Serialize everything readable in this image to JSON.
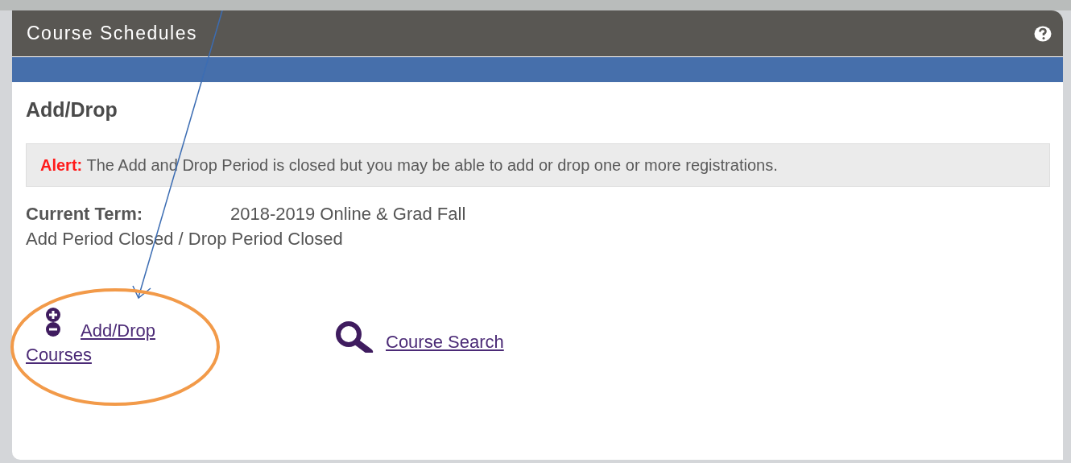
{
  "panel": {
    "title": "Course Schedules"
  },
  "heading": "Add/Drop",
  "alert": {
    "label": "Alert:",
    "message": "The Add and Drop Period is closed but you may be able to add or drop one or more registrations."
  },
  "current_term": {
    "label": "Current Term:",
    "value": "2018-2019 Online & Grad Fall"
  },
  "period_status": "Add Period Closed / Drop Period Closed",
  "links": [
    {
      "kind": "add-drop",
      "label": "Add/Drop Courses"
    },
    {
      "kind": "search",
      "label": "Course Search"
    }
  ]
}
